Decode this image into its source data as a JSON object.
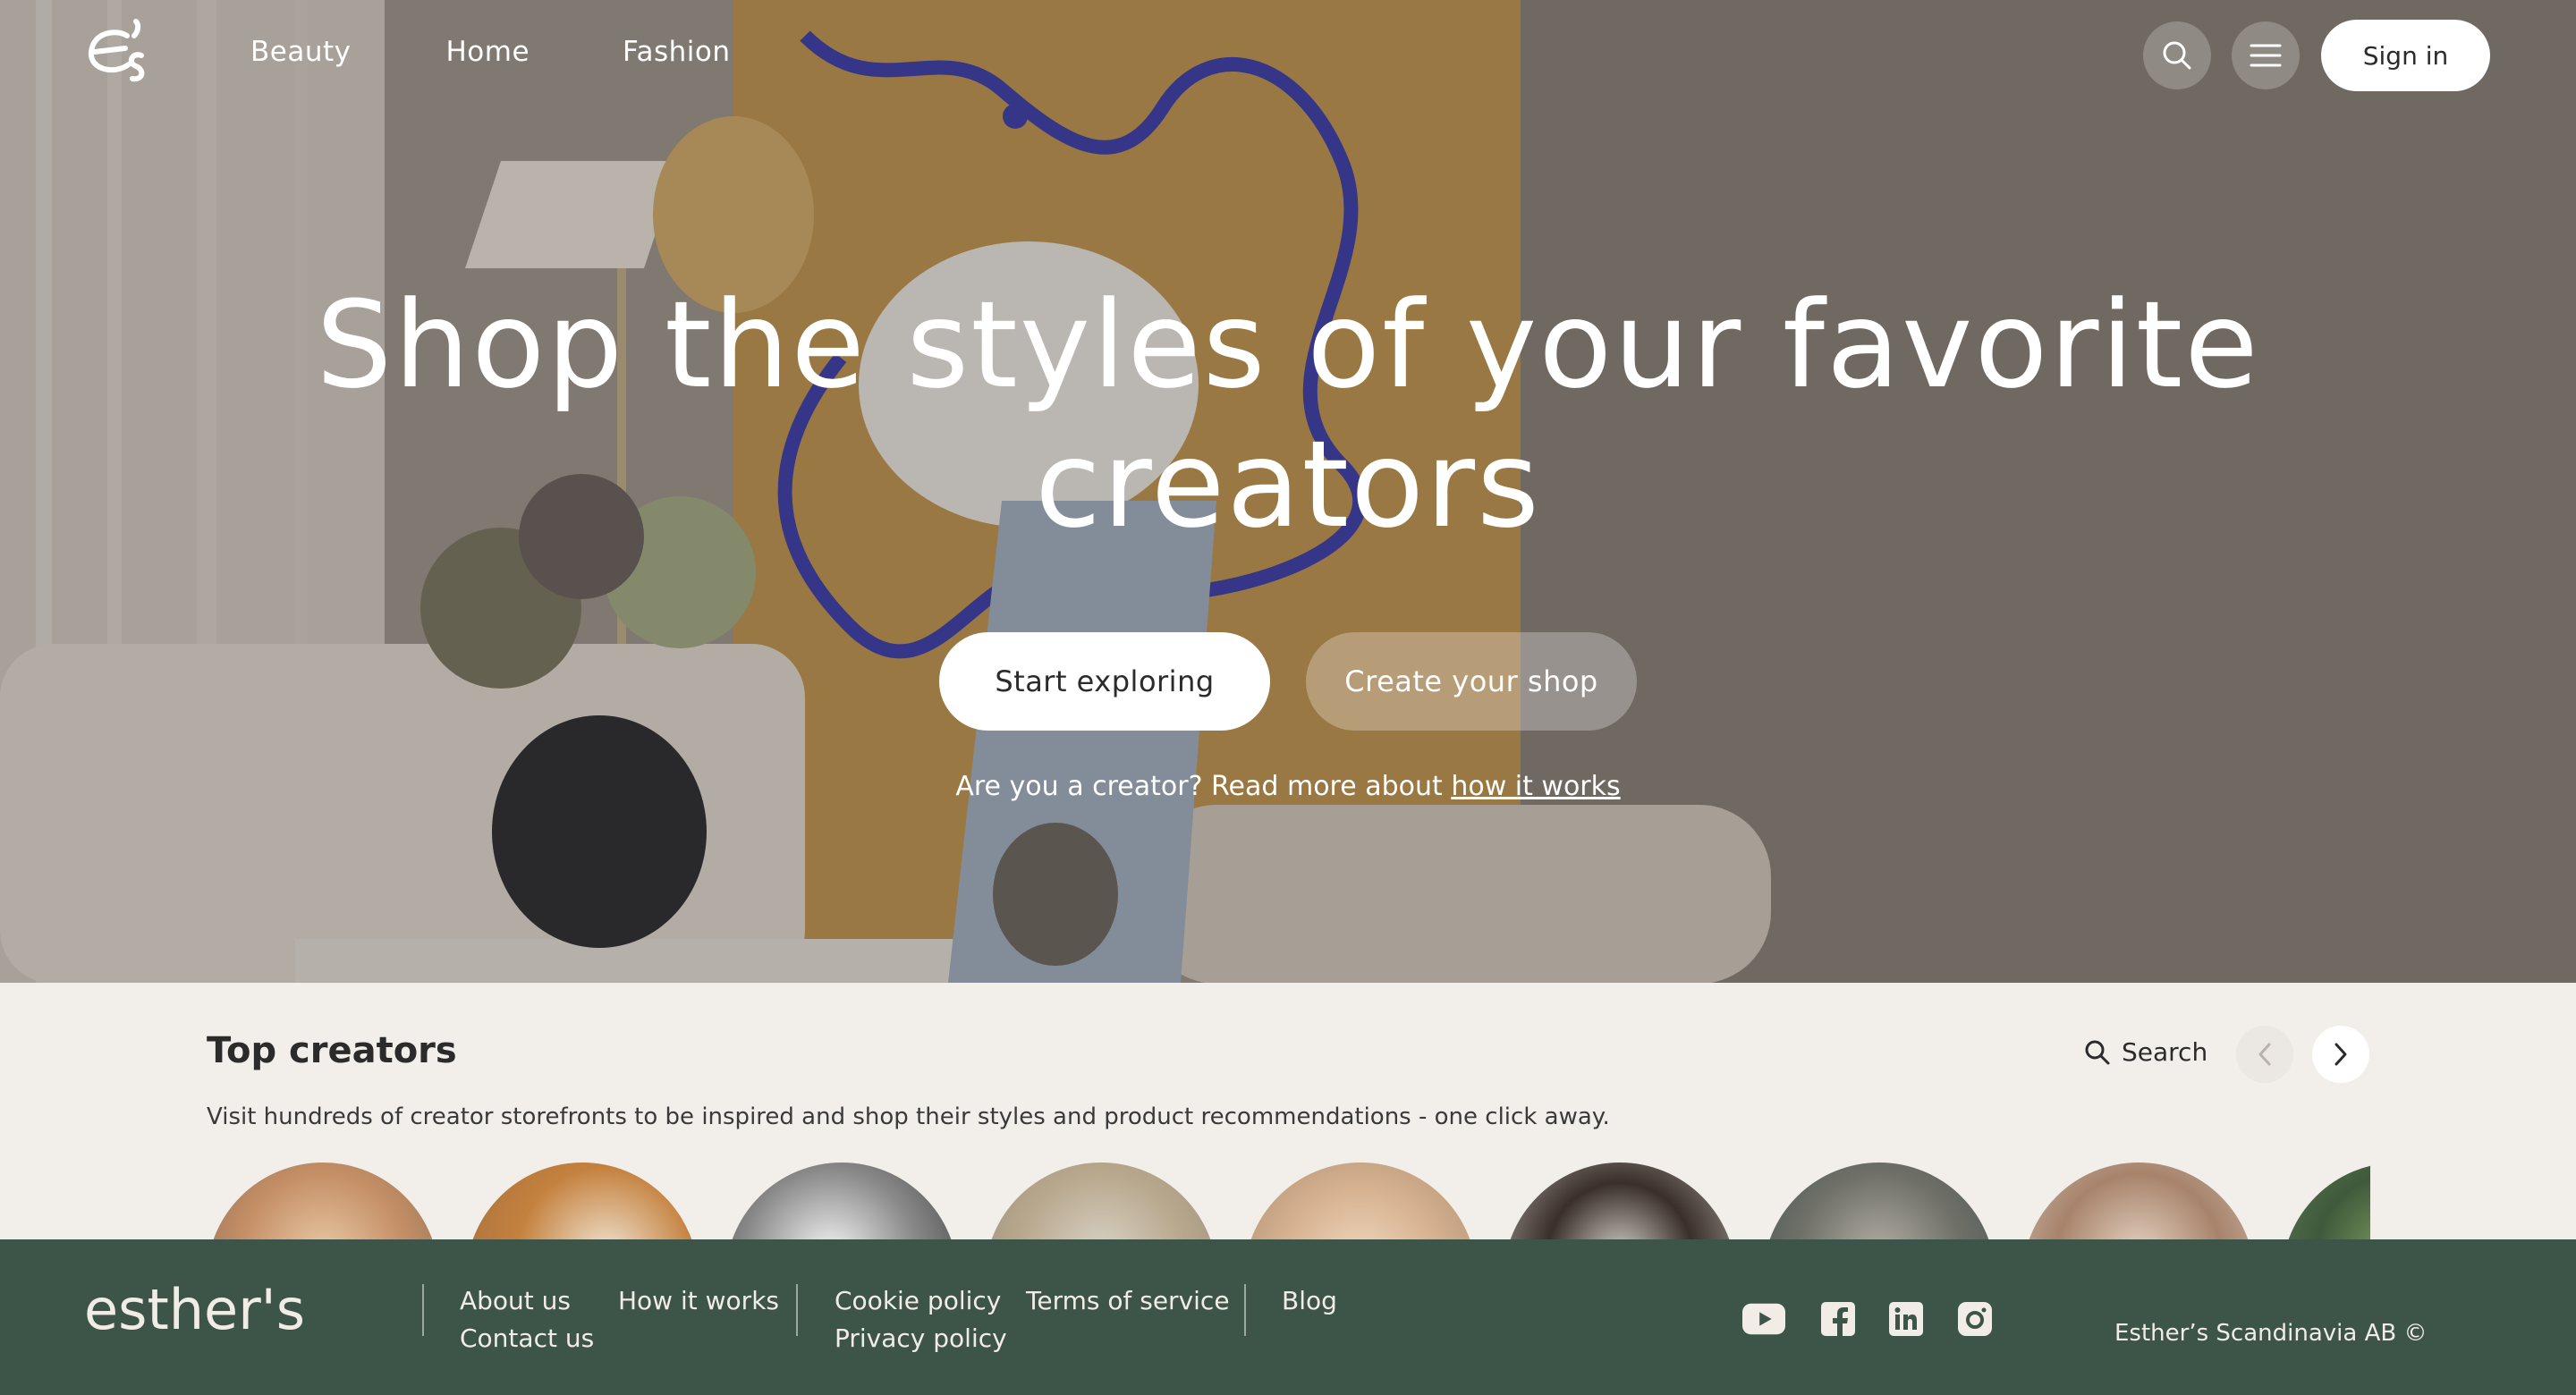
{
  "header": {
    "logo_alt": "es",
    "nav": [
      "Beauty",
      "Home",
      "Fashion"
    ],
    "icons": {
      "search": "search-icon",
      "menu": "hamburger-menu-icon"
    },
    "signin_label": "Sign in"
  },
  "hero": {
    "headline_line1": "Shop the styles of your favorite",
    "headline_line2": "creators",
    "primary_cta": "Start exploring",
    "secondary_cta": "Create your shop",
    "creator_prompt": "Are you a creator? Read more about",
    "creator_link": "how it works"
  },
  "top_creators": {
    "title": "Top creators",
    "subtitle": "Visit hundreds of creator storefronts to be inspired and shop their styles and product recommendations - one click away.",
    "search_label": "Search",
    "icons": {
      "search": "search-icon",
      "prev": "chevron-left-icon",
      "next": "chevron-right-icon"
    }
  },
  "footer": {
    "wordmark": "esther's",
    "links": {
      "about": "About us",
      "contact": "Contact us",
      "how": "How it works",
      "cookie": "Cookie policy",
      "privacy": "Privacy policy",
      "terms": "Terms of service",
      "blog": "Blog"
    },
    "social_icons": [
      "youtube-icon",
      "facebook-icon",
      "linkedin-icon",
      "instagram-icon"
    ],
    "copyright": "Esther’s Scandinavia AB ©"
  },
  "colors": {
    "footer_bg": "#3d5448",
    "page_bg": "#f2efeb",
    "text_dark": "#2b2b2b",
    "button_white": "#ffffff"
  }
}
